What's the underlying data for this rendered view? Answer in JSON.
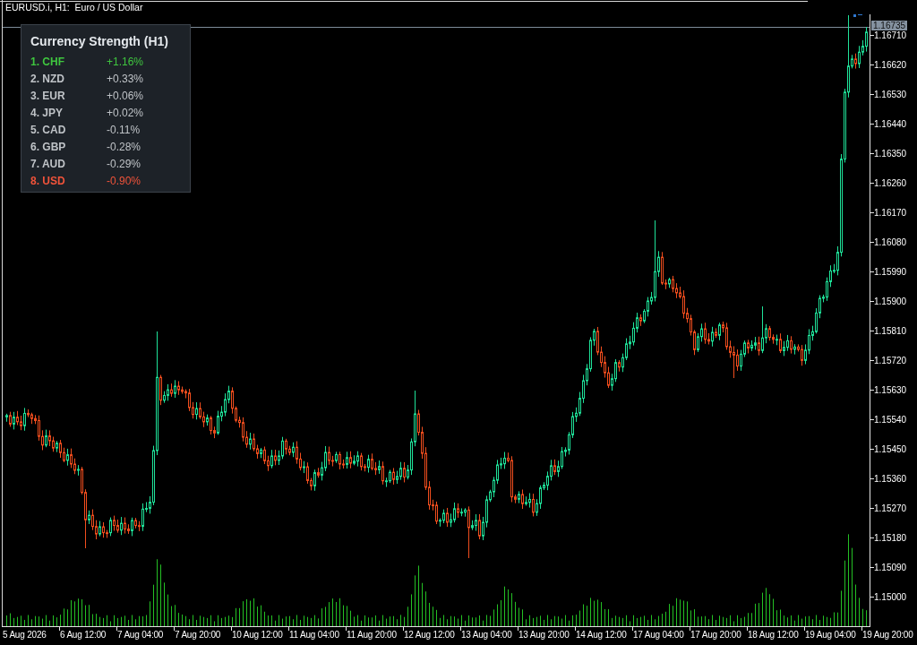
{
  "chart": {
    "title": "EURUSD.i, H1:  Euro / US Dollar"
  },
  "strength_panel": {
    "title": "Currency Strength (H1)",
    "rows": [
      {
        "label": "1. CHF",
        "change": "+1.16%",
        "color": "#3fc63f"
      },
      {
        "label": "2. NZD",
        "change": "+0.33%",
        "color": "#bfc3c7"
      },
      {
        "label": "3. EUR",
        "change": "+0.06%",
        "color": "#bfc3c7"
      },
      {
        "label": "4. JPY",
        "change": "+0.02%",
        "color": "#bfc3c7"
      },
      {
        "label": "5. CAD",
        "change": "-0.11%",
        "color": "#bfc3c7"
      },
      {
        "label": "6. GBP",
        "change": "-0.28%",
        "color": "#bfc3c7"
      },
      {
        "label": "7. AUD",
        "change": "-0.29%",
        "color": "#bfc3c7"
      },
      {
        "label": "8. USD",
        "change": "-0.90%",
        "color": "#f0533a"
      }
    ]
  },
  "price_axis": {
    "current_price": "1.16735",
    "labels": [
      "1.16710",
      "1.16620",
      "1.16530",
      "1.16440",
      "1.16350",
      "1.16260",
      "1.16170",
      "1.16080",
      "1.15990",
      "1.15900",
      "1.15810",
      "1.15720",
      "1.15630",
      "1.15540",
      "1.15450",
      "1.15360",
      "1.15270",
      "1.15180",
      "1.15090",
      "1.15000"
    ]
  },
  "time_axis": {
    "labels": [
      "5 Aug 2026",
      "6 Aug 12:00",
      "7 Aug 04:00",
      "7 Aug 20:00",
      "10 Aug 12:00",
      "11 Aug 04:00",
      "11 Aug 20:00",
      "12 Aug 12:00",
      "13 Aug 04:00",
      "13 Aug 20:00",
      "14 Aug 12:00",
      "17 Aug 04:00",
      "17 Aug 20:00",
      "18 Aug 12:00",
      "19 Aug 04:00",
      "19 Aug 20:00"
    ]
  }
}
